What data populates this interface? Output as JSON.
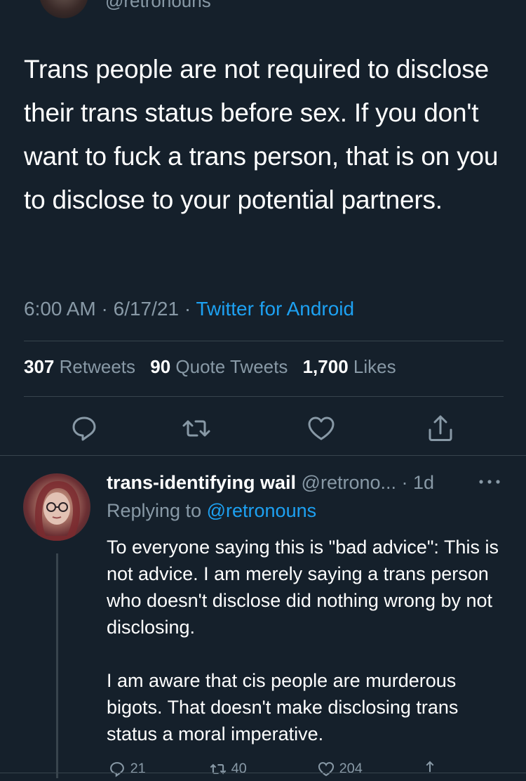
{
  "top": {
    "handle": "@retronouns"
  },
  "tweet": {
    "text": "Trans people are not required to disclose their trans status before sex. If you don't want to fuck a trans person, that is on you to disclose to your potential partners.",
    "time": "6:00 AM",
    "date": "6/17/21",
    "source": "Twitter for Android"
  },
  "stats": {
    "retweets_count": "307",
    "retweets_label": "Retweets",
    "quotes_count": "90",
    "quotes_label": "Quote Tweets",
    "likes_count": "1,700",
    "likes_label": "Likes"
  },
  "actions": [
    "reply-icon",
    "retweet-icon",
    "like-icon",
    "share-icon"
  ],
  "reply": {
    "name": "trans-identifying wail",
    "handle": "@retrono...",
    "age": "1d",
    "replying_prefix": "Replying to",
    "replying_handle": "@retronouns",
    "text1": "To everyone saying this is \"bad advice\": This is not advice. I am merely saying a trans person who doesn't disclose did nothing wrong by not disclosing.",
    "text2": "I am aware that cis people are murderous bigots. That doesn't make disclosing trans status a moral imperative.",
    "reply_count": "21",
    "retweet_count": "40",
    "like_count": "204"
  },
  "colors": {
    "background": "#15202b",
    "secondary_text": "#8899a6",
    "link": "#1da1f2",
    "divider": "#38444d"
  }
}
